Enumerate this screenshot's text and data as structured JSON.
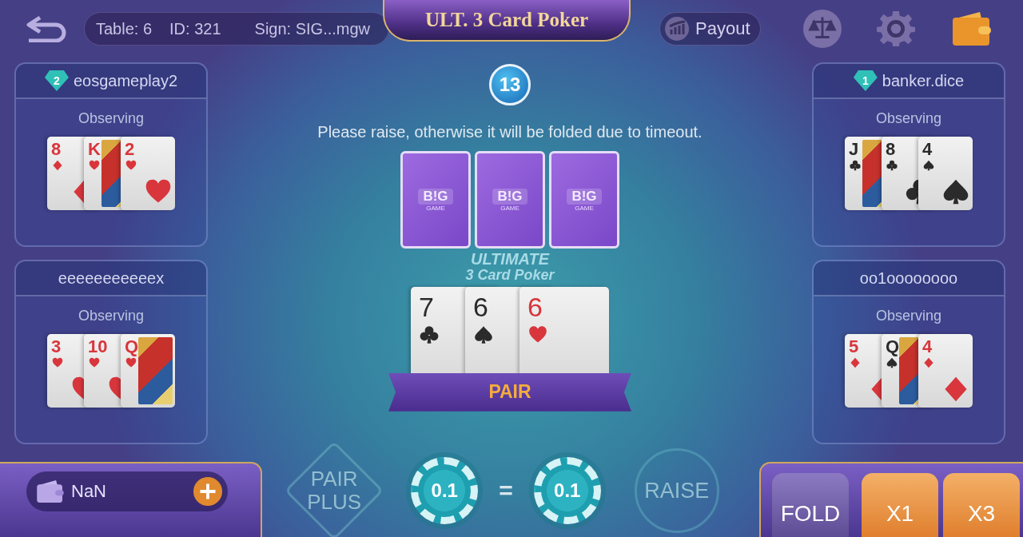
{
  "top_bar": {
    "table": "Table: 6",
    "id": "ID: 321",
    "sign": "Sign: SIG...mgw",
    "title": "ULT. 3 Card Poker",
    "payout": "Payout"
  },
  "left_players": [
    {
      "name": "eosgameplay2",
      "badge": "2",
      "status": "Observing",
      "cards": [
        {
          "rank": "8",
          "kind": "diamonds",
          "face": false
        },
        {
          "rank": "K",
          "kind": "hearts",
          "face": true
        },
        {
          "rank": "2",
          "kind": "hearts",
          "face": false
        }
      ]
    },
    {
      "name": "eeeeeeeeeeex",
      "status": "Observing",
      "cards": [
        {
          "rank": "3",
          "kind": "hearts",
          "face": false
        },
        {
          "rank": "10",
          "kind": "hearts",
          "face": false
        },
        {
          "rank": "Q",
          "kind": "hearts",
          "face": true
        }
      ]
    }
  ],
  "timer": {
    "count": "13"
  },
  "message": "Please raise, otherwise it will be folded due to timeout.",
  "card_backs": [
    {
      "logo": "B!G",
      "sub": "GAME"
    },
    {
      "logo": "B!G",
      "sub": "GAME"
    },
    {
      "logo": "B!G",
      "sub": "GAME"
    }
  ],
  "table_logo": {
    "line1": "ULTIMATE",
    "line2": "3 Card Poker"
  },
  "hand": {
    "cards": [
      {
        "rank": "7",
        "kind": "clubs",
        "face": false
      },
      {
        "rank": "6",
        "kind": "spades",
        "face": false
      },
      {
        "rank": "6",
        "kind": "hearts",
        "face": false
      }
    ],
    "result": "PAIR"
  },
  "right_players": [
    {
      "name": "banker.dice",
      "badge": "1",
      "status": "Observing",
      "cards": [
        {
          "rank": "J",
          "kind": "clubs",
          "face": true
        },
        {
          "rank": "8",
          "kind": "clubs",
          "face": false
        },
        {
          "rank": "4",
          "kind": "spades",
          "face": false
        }
      ]
    },
    {
      "name": "oo1oooooooo",
      "status": "Observing",
      "cards": [
        {
          "rank": "5",
          "kind": "diamonds",
          "face": false
        },
        {
          "rank": "Q",
          "kind": "spades",
          "face": true
        },
        {
          "rank": "4",
          "kind": "diamonds",
          "face": false
        }
      ]
    }
  ],
  "wallet": {
    "balance": "NaN"
  },
  "bets": {
    "pair_plus": "PAIR PLUS",
    "ante": "0.1",
    "equals": "=",
    "play": "0.1",
    "raise": "RAISE"
  },
  "actions": [
    {
      "label": "FOLD",
      "kind": "fold"
    },
    {
      "label": "X1",
      "kind": "raise"
    },
    {
      "label": "X3",
      "kind": "raise"
    }
  ]
}
